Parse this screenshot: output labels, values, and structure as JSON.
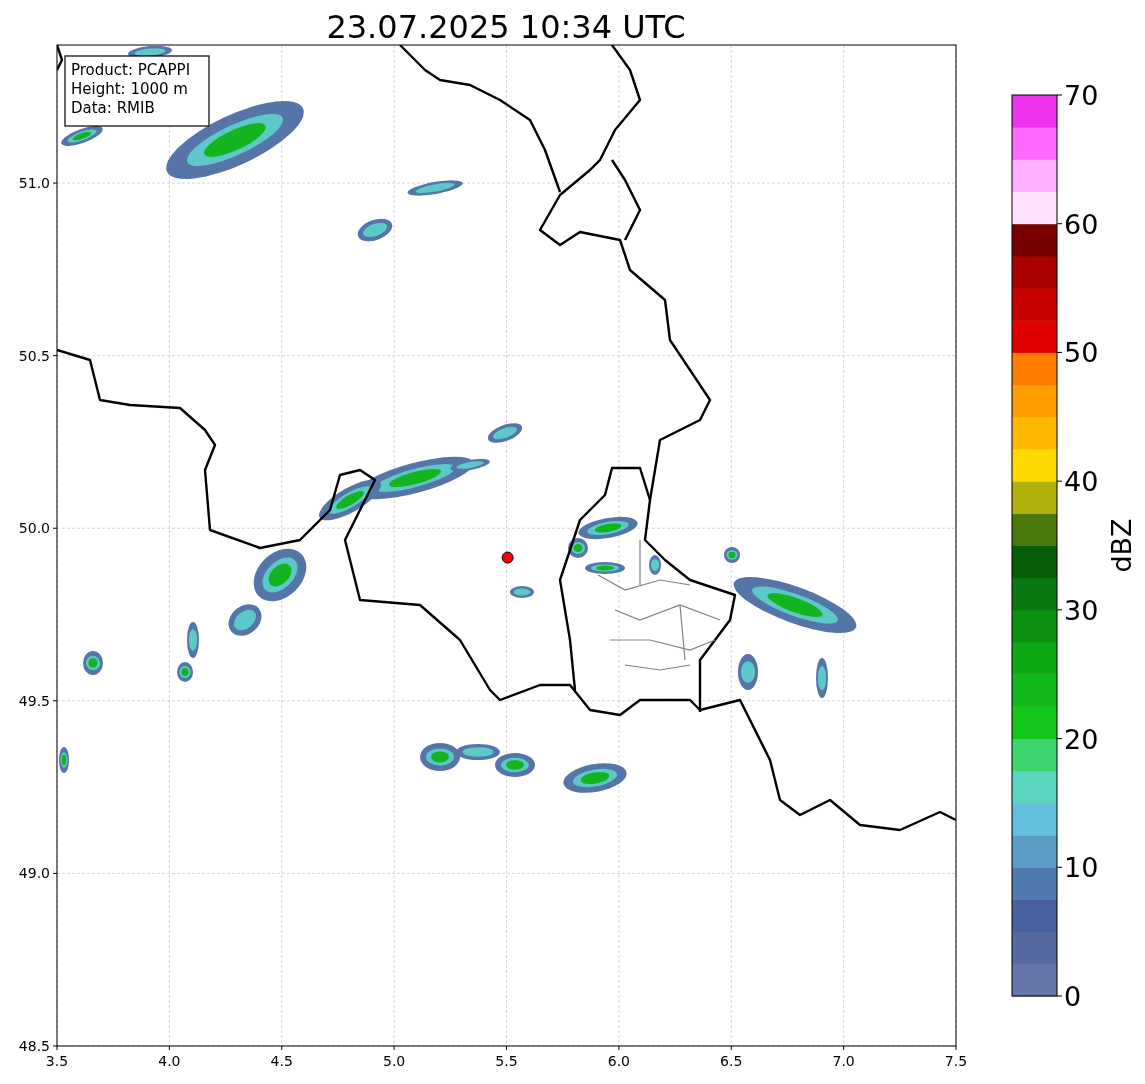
{
  "plot": {
    "chart_data": {
      "type": "scatter",
      "title": "23.07.2025 10:34 UTC",
      "xlim": [
        3.5,
        7.5
      ],
      "ylim": [
        48.5,
        51.4
      ],
      "grid": true,
      "xticks": [
        {
          "value": 3.5,
          "label": "3.5"
        },
        {
          "value": 4.0,
          "label": "4.0"
        },
        {
          "value": 4.5,
          "label": "4.5"
        },
        {
          "value": 5.0,
          "label": "5.0"
        },
        {
          "value": 5.5,
          "label": "5.5"
        },
        {
          "value": 6.0,
          "label": "6.0"
        },
        {
          "value": 6.5,
          "label": "6.5"
        },
        {
          "value": 7.0,
          "label": "7.0"
        },
        {
          "value": 7.5,
          "label": "7.5"
        }
      ],
      "yticks": [
        {
          "value": 48.5,
          "label": "48.5"
        },
        {
          "value": 49.0,
          "label": "49.0"
        },
        {
          "value": 49.5,
          "label": "49.5"
        },
        {
          "value": 50.0,
          "label": "50.0"
        },
        {
          "value": 50.5,
          "label": "50.5"
        },
        {
          "value": 51.0,
          "label": "51.0"
        }
      ],
      "series": [
        {
          "color": "#ff0000",
          "x": [
            5.505
          ],
          "values": [
            49.915
          ]
        }
      ]
    },
    "info_box": [
      "Product: PCAPPI",
      "Height: 1000 m",
      "Data: RMIB"
    ]
  },
  "colorbar": {
    "label": "dBZ",
    "ticks": [
      "70",
      "60",
      "50",
      "40",
      "30",
      "20",
      "10",
      "0"
    ],
    "segments": [
      {
        "color": "#6577a8"
      },
      {
        "color": "#5668a0"
      },
      {
        "color": "#4760a0"
      },
      {
        "color": "#4f7ab0"
      },
      {
        "color": "#5a9cc4"
      },
      {
        "color": "#62c0dc"
      },
      {
        "color": "#5cd6c0"
      },
      {
        "color": "#3dd46e"
      },
      {
        "color": "#12c81a"
      },
      {
        "color": "#10b81a"
      },
      {
        "color": "#0ea814"
      },
      {
        "color": "#0c9010"
      },
      {
        "color": "#0a7810"
      },
      {
        "color": "#075e0a"
      },
      {
        "color": "#4a780a"
      },
      {
        "color": "#b0b00a"
      },
      {
        "color": "#ffd800"
      },
      {
        "color": "#ffb800"
      },
      {
        "color": "#ff9c00"
      },
      {
        "color": "#ff7c00"
      },
      {
        "color": "#e00000"
      },
      {
        "color": "#c80000"
      },
      {
        "color": "#a80000"
      },
      {
        "color": "#780000"
      },
      {
        "color": "#ffe0ff"
      },
      {
        "color": "#ffb0ff"
      },
      {
        "color": "#ff68ff"
      },
      {
        "color": "#ee33ee"
      }
    ]
  }
}
